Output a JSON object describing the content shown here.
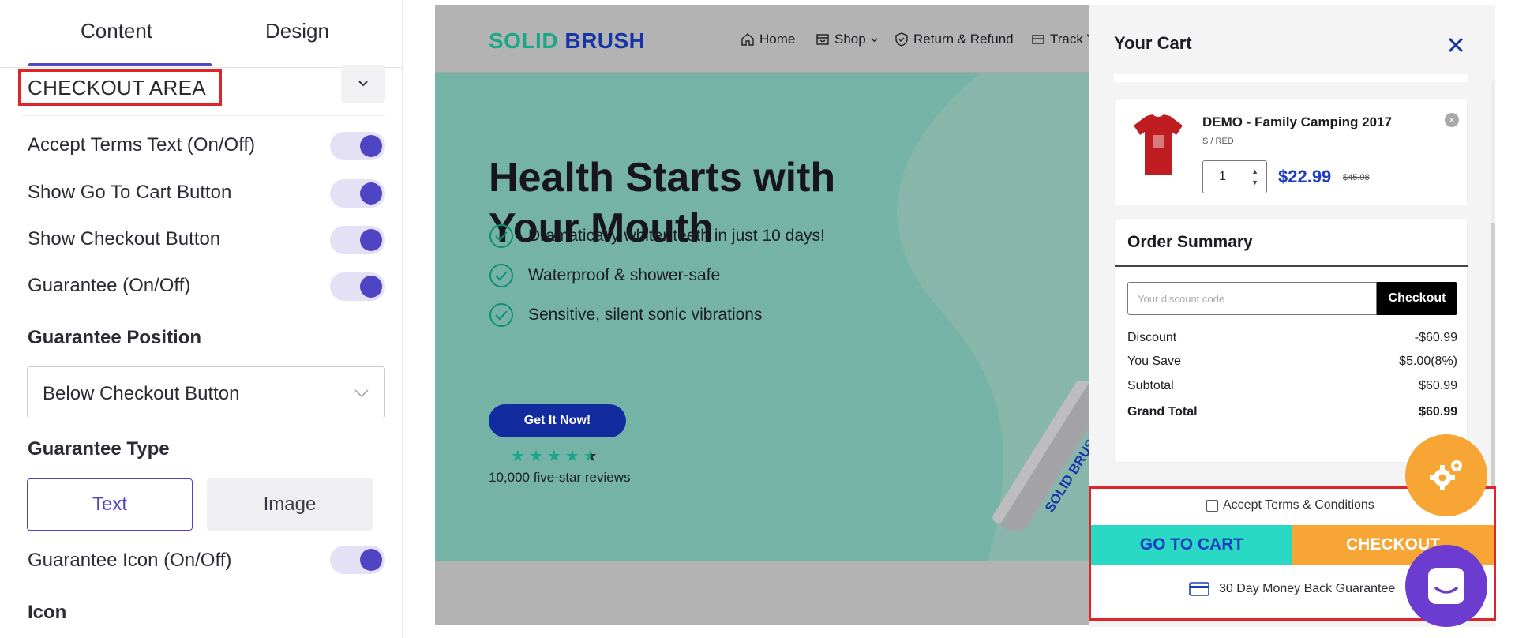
{
  "panel": {
    "tabs": [
      {
        "label": "Content"
      },
      {
        "label": "Design"
      }
    ],
    "section_title": "CHECKOUT AREA",
    "toggles": [
      {
        "label": "Accept Terms Text (On/Off)",
        "on": true
      },
      {
        "label": "Show Go To Cart Button",
        "on": true
      },
      {
        "label": "Show Checkout Button",
        "on": true
      },
      {
        "label": "Guarantee (On/Off)",
        "on": true
      }
    ],
    "guarantee_position_label": "Guarantee Position",
    "guarantee_position_value": "Below Checkout Button",
    "guarantee_type_label": "Guarantee Type",
    "guarantee_type_options": [
      "Text",
      "Image"
    ],
    "guarantee_type_selected": "Text",
    "guarantee_icon_label": "Guarantee Icon (On/Off)",
    "guarantee_icon_on": true,
    "icon_label": "Icon",
    "accent_color": "#4e45c4"
  },
  "site": {
    "logo_part1": "SOLID",
    "logo_part2": "BRUSH",
    "nav": [
      {
        "label": "Home",
        "icon": "home-icon"
      },
      {
        "label": "Shop",
        "icon": "shop-icon"
      },
      {
        "label": "Return & Refund",
        "icon": "shield-icon"
      },
      {
        "label": "Track Y",
        "icon": "truck-icon"
      }
    ],
    "hero_title": "Health Starts with Your Mouth",
    "bullets": [
      "Dramatically whiter teeth in just 10 days!",
      "Waterproof & shower-safe",
      "Sensitive, silent sonic vibrations"
    ],
    "cta_label": "Get It Now!",
    "rating_stars": 4.5,
    "reviews": "10,000 five-star reviews",
    "product_label": "SOLID BRUSH"
  },
  "cart": {
    "title": "Your Cart",
    "item": {
      "name": "DEMO - Family Camping 2017",
      "variant": "S / RED",
      "qty": "1",
      "price": "$22.99",
      "old_price": "$45.98"
    },
    "summary_title": "Order Summary",
    "discount_placeholder": "Your discount code",
    "discount_button": "Checkout",
    "rows": [
      {
        "label": "Discount",
        "value": "-$60.99"
      },
      {
        "label": "You Save",
        "value": "$5.00(8%)"
      },
      {
        "label": "Subtotal",
        "value": "$60.99"
      },
      {
        "label": "Grand Total",
        "value": "$60.99"
      }
    ],
    "terms_label": "Accept Terms & Conditions",
    "goto_cart": "GO TO CART",
    "checkout": "CHECKOUT",
    "guarantee": "30 Day Money Back Guarantee"
  }
}
